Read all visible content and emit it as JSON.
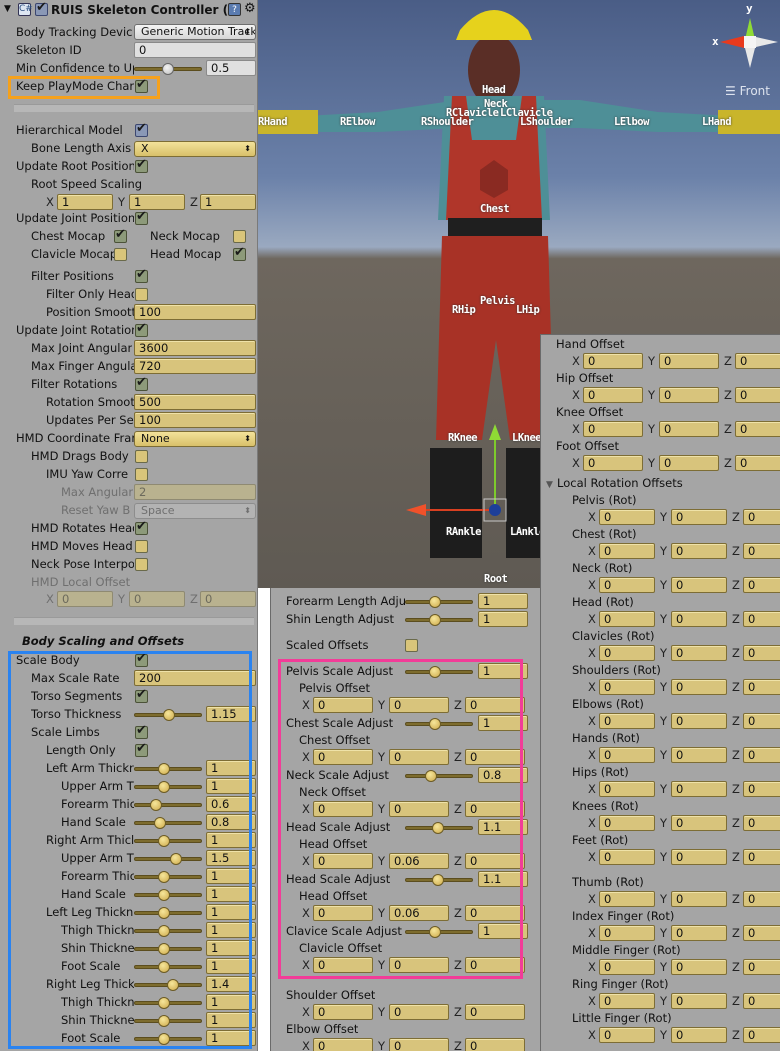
{
  "component": {
    "title": "RUIS Skeleton Controller (S",
    "enabled": true,
    "help_icon": "help-book-icon",
    "gear_icon": "gear-icon",
    "script_icon": "csharp-script-icon"
  },
  "left": {
    "body_tracking_device": {
      "label": "Body Tracking Devic",
      "value": "Generic Motion Track"
    },
    "skeleton_id": {
      "label": "Skeleton ID",
      "value": "0"
    },
    "min_confidence": {
      "label": "Min Confidence to Up",
      "value": "0.5",
      "slider": 0.5
    },
    "keep_playmode": {
      "label": "Keep PlayMode Char",
      "checked": true
    },
    "hierarchical_model": {
      "label": "Hierarchical Model",
      "checked": true
    },
    "bone_length_axis": {
      "label": "Bone Length Axis",
      "value": "X"
    },
    "update_root_position": {
      "label": "Update Root Position",
      "checked": true
    },
    "root_speed_scaling": {
      "label": "Root Speed Scaling",
      "x": "1",
      "y": "1",
      "z": "1"
    },
    "update_joint_positions": {
      "label": "Update Joint Position",
      "checked": true
    },
    "chest_mocap": {
      "label": "Chest Mocap",
      "checked": true
    },
    "neck_mocap": {
      "label": "Neck Mocap",
      "checked": false
    },
    "clavicle_mocap": {
      "label": "Clavicle Mocap",
      "checked": false
    },
    "head_mocap": {
      "label": "Head Mocap",
      "checked": true
    },
    "filter_positions": {
      "label": "Filter Positions",
      "checked": true
    },
    "filter_only_head": {
      "label": "Filter Only Head",
      "checked": false
    },
    "position_smoothing": {
      "label": "Position Smoott",
      "value": "100"
    },
    "update_joint_rotations": {
      "label": "Update Joint Rotation",
      "checked": true
    },
    "max_joint_angular": {
      "label": "Max Joint Angular",
      "value": "3600"
    },
    "max_finger_angular": {
      "label": "Max Finger Angula",
      "value": "720"
    },
    "filter_rotations": {
      "label": "Filter Rotations",
      "checked": true
    },
    "rotation_smoothing": {
      "label": "Rotation Smoot",
      "value": "500"
    },
    "updates_per_second": {
      "label": "Updates Per Se",
      "value": "100"
    },
    "hmd_coordinate_frame": {
      "label": "HMD Coordinate Fran",
      "value": "None"
    },
    "hmd_drags_body": {
      "label": "HMD Drags Body",
      "checked": false
    },
    "imu_yaw_correction": {
      "label": "IMU Yaw Corre",
      "checked": false
    },
    "max_angular": {
      "label": "Max Angular",
      "value": "2"
    },
    "reset_yaw_button": {
      "label": "Reset Yaw B",
      "value": "Space"
    },
    "hmd_rotates_head": {
      "label": "HMD Rotates Head",
      "checked": true
    },
    "hmd_moves_head": {
      "label": "HMD Moves Head",
      "checked": false
    },
    "neck_pose_interp": {
      "label": "Neck Pose Interpo",
      "checked": false
    },
    "hmd_local_offset": {
      "label": "HMD Local Offset",
      "x": "0",
      "y": "0",
      "z": "0"
    },
    "body_scaling_title": "Body Scaling and Offsets",
    "scale_body": {
      "label": "Scale Body",
      "checked": true
    },
    "max_scale_rate": {
      "label": "Max Scale Rate",
      "value": "200"
    },
    "torso_segments": {
      "label": "Torso Segments",
      "checked": true
    },
    "torso_thickness": {
      "label": "Torso Thickness",
      "value": "1.15",
      "slider": 0.4
    },
    "scale_limbs": {
      "label": "Scale Limbs",
      "checked": true
    },
    "length_only": {
      "label": "Length Only",
      "checked": true
    },
    "limb_sliders": [
      {
        "label": "Left Arm Thickr",
        "value": "1",
        "slider": 0.33
      },
      {
        "label": "Upper Arm T",
        "value": "1",
        "slider": 0.33
      },
      {
        "label": "Forearm Thic",
        "value": "0.6",
        "slider": 0.2
      },
      {
        "label": "Hand Scale",
        "value": "0.8",
        "slider": 0.27
      },
      {
        "label": "Right Arm Thicl",
        "value": "1",
        "slider": 0.33
      },
      {
        "label": "Upper Arm T",
        "value": "1.5",
        "slider": 0.5
      },
      {
        "label": "Forearm Thic",
        "value": "1",
        "slider": 0.33
      },
      {
        "label": "Hand Scale",
        "value": "1",
        "slider": 0.33
      },
      {
        "label": "Left Leg Thickn",
        "value": "1",
        "slider": 0.33
      },
      {
        "label": "Thigh Thickn",
        "value": "1",
        "slider": 0.33
      },
      {
        "label": "Shin Thickne",
        "value": "1",
        "slider": 0.33
      },
      {
        "label": "Foot Scale",
        "value": "1",
        "slider": 0.33
      },
      {
        "label": "Right Leg Thick",
        "value": "1.4",
        "slider": 0.45
      },
      {
        "label": "Thigh Thickn",
        "value": "1",
        "slider": 0.33
      },
      {
        "label": "Shin Thickne",
        "value": "1",
        "slider": 0.33
      },
      {
        "label": "Foot Scale",
        "value": "1",
        "slider": 0.33
      }
    ]
  },
  "middle": {
    "forearm_length": {
      "label": "Forearm Length Adju",
      "value": "1",
      "slider": 0.33
    },
    "shin_length": {
      "label": "Shin Length Adjust",
      "value": "1",
      "slider": 0.33
    },
    "scaled_offsets": {
      "label": "Scaled Offsets",
      "checked": false
    },
    "groups": [
      {
        "scale_label": "Pelvis Scale Adjust",
        "scale_value": "1",
        "slider": 0.33,
        "offset_label": "Pelvis Offset",
        "x": "0",
        "y": "0",
        "z": "0"
      },
      {
        "scale_label": "Chest Scale Adjust",
        "scale_value": "1",
        "slider": 0.33,
        "offset_label": "Chest Offset",
        "x": "0",
        "y": "0",
        "z": "0"
      },
      {
        "scale_label": "Neck Scale Adjust",
        "scale_value": "0.8",
        "slider": 0.27,
        "offset_label": "Neck Offset",
        "x": "0",
        "y": "0",
        "z": "0"
      },
      {
        "scale_label": "Head Scale Adjust",
        "scale_value": "1.1",
        "slider": 0.37,
        "offset_label": "Head Offset",
        "x": "0",
        "y": "0.06",
        "z": "0"
      },
      {
        "scale_label": "Head Scale Adjust",
        "scale_value": "1.1",
        "slider": 0.37,
        "offset_label": "Head Offset",
        "x": "0",
        "y": "0.06",
        "z": "0"
      },
      {
        "scale_label": "Clavice Scale Adjust",
        "scale_value": "1",
        "slider": 0.33,
        "offset_label": "Clavicle Offset",
        "x": "0",
        "y": "0",
        "z": "0"
      }
    ],
    "offsets": [
      {
        "label": "Shoulder Offset",
        "x": "0",
        "y": "0",
        "z": "0"
      },
      {
        "label": "Elbow Offset",
        "x": "0",
        "y": "0",
        "z": "0"
      }
    ]
  },
  "right": {
    "offsets": [
      {
        "label": "Hand Offset",
        "x": "0",
        "y": "0",
        "z": "0"
      },
      {
        "label": "Hip Offset",
        "x": "0",
        "y": "0",
        "z": "0"
      },
      {
        "label": "Knee Offset",
        "x": "0",
        "y": "0",
        "z": "0"
      },
      {
        "label": "Foot Offset",
        "x": "0",
        "y": "0",
        "z": "0"
      }
    ],
    "local_rotation_title": "Local Rotation Offsets",
    "rotations": [
      {
        "label": "Pelvis (Rot)",
        "x": "0",
        "y": "0",
        "z": "0"
      },
      {
        "label": "Chest (Rot)",
        "x": "0",
        "y": "0",
        "z": "0"
      },
      {
        "label": "Neck (Rot)",
        "x": "0",
        "y": "0",
        "z": "0"
      },
      {
        "label": "Head (Rot)",
        "x": "0",
        "y": "0",
        "z": "0"
      },
      {
        "label": "Clavicles (Rot)",
        "x": "0",
        "y": "0",
        "z": "0"
      },
      {
        "label": "Shoulders (Rot)",
        "x": "0",
        "y": "0",
        "z": "0"
      },
      {
        "label": "Elbows (Rot)",
        "x": "0",
        "y": "0",
        "z": "0"
      },
      {
        "label": "Hands (Rot)",
        "x": "0",
        "y": "0",
        "z": "0"
      },
      {
        "label": "Hips (Rot)",
        "x": "0",
        "y": "0",
        "z": "0"
      },
      {
        "label": "Knees (Rot)",
        "x": "0",
        "y": "0",
        "z": "0"
      },
      {
        "label": "Feet (Rot)",
        "x": "0",
        "y": "0",
        "z": "0"
      },
      {
        "label": "Thumb (Rot)",
        "x": "0",
        "y": "0",
        "z": "0"
      },
      {
        "label": "Index Finger (Rot)",
        "x": "0",
        "y": "0",
        "z": "0"
      },
      {
        "label": "Middle Finger (Rot)",
        "x": "0",
        "y": "0",
        "z": "0"
      },
      {
        "label": "Ring Finger (Rot)",
        "x": "0",
        "y": "0",
        "z": "0"
      },
      {
        "label": "Little Finger (Rot)",
        "x": "0",
        "y": "0",
        "z": "0"
      }
    ]
  },
  "viewport": {
    "view_label": "Front",
    "axis_x": "x",
    "axis_y": "y",
    "joint_labels": [
      "Head",
      "Neck",
      "RClavicle",
      "LClavicle",
      "RHand",
      "RElbow",
      "RShoulder",
      "LShoulder",
      "LElbow",
      "LHand",
      "Chest",
      "Pelvis",
      "RHip",
      "LHip",
      "RKnee",
      "LKnee",
      "RAnkle",
      "LAnkle",
      "Root"
    ]
  },
  "axes": {
    "x": "X",
    "y": "Y",
    "z": "Z"
  },
  "colors": {
    "highlight_orange": "#f5a11c",
    "highlight_blue": "#2a83f0",
    "highlight_pink": "#f23c98",
    "field_yellow": "#d8c47c",
    "panel_gray": "#a5a5a5"
  }
}
